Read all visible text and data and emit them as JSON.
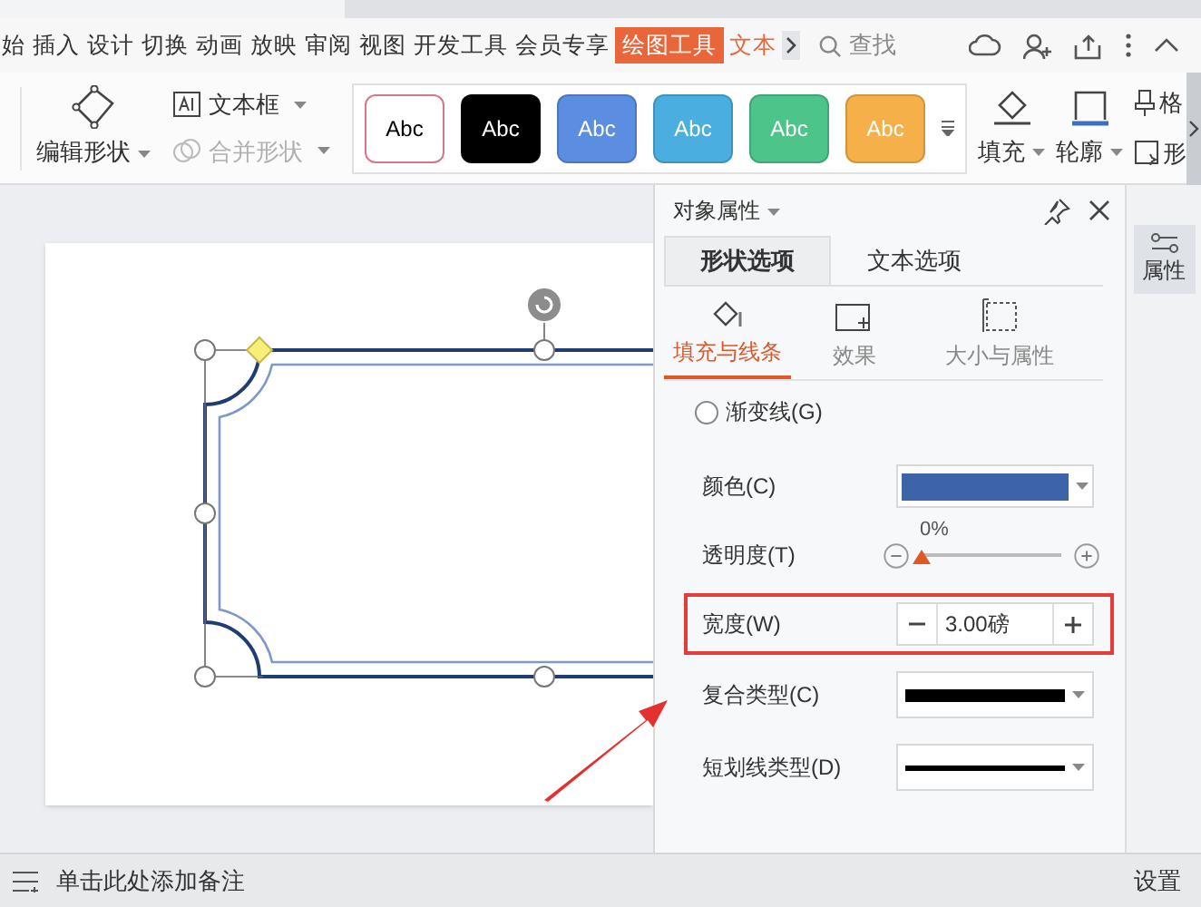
{
  "menu_tabs": [
    {
      "label": "始",
      "selected": false
    },
    {
      "label": "插入",
      "selected": false
    },
    {
      "label": "设计",
      "selected": false
    },
    {
      "label": "切换",
      "selected": false
    },
    {
      "label": "动画",
      "selected": false
    },
    {
      "label": "放映",
      "selected": false
    },
    {
      "label": "审阅",
      "selected": false
    },
    {
      "label": "视图",
      "selected": false
    },
    {
      "label": "开发工具",
      "selected": false
    },
    {
      "label": "会员专享",
      "selected": false
    },
    {
      "label": "绘图工具",
      "selected": true
    },
    {
      "label": "文本",
      "selected": false
    }
  ],
  "search": {
    "placeholder": "查找"
  },
  "ribbon": {
    "edit_shape": "编辑形状",
    "text_box": "文本框",
    "merge_shape": {
      "label": "合并形状",
      "disabled": true
    },
    "styles": [
      {
        "label": "Abc",
        "color": "#ffffff"
      },
      {
        "label": "Abc",
        "color": "#000000"
      },
      {
        "label": "Abc",
        "color": "#5b8ee0"
      },
      {
        "label": "Abc",
        "color": "#4aaee0"
      },
      {
        "label": "Abc",
        "color": "#4dc48a"
      },
      {
        "label": "Abc",
        "color": "#f6b04a"
      }
    ],
    "fill": "填充",
    "outline": "轮廓",
    "format_cut": "格",
    "shape_cut": "形"
  },
  "panel": {
    "title": "对象属性",
    "tabs": [
      {
        "label": "形状选项",
        "selected": true
      },
      {
        "label": "文本选项",
        "selected": false
      }
    ],
    "subtabs": [
      {
        "label": "填充与线条",
        "selected": true
      },
      {
        "label": "效果",
        "selected": false
      },
      {
        "label": "大小与属性",
        "selected": false
      }
    ],
    "gradient_line": {
      "label": "渐变线(G)",
      "selected": false
    },
    "color": {
      "label": "颜色(C)",
      "color": "#3d64a8"
    },
    "transparency": {
      "label": "透明度(T)",
      "reading": "0%",
      "level": 0
    },
    "width": {
      "label": "宽度(W)",
      "value": "3.00磅",
      "highlighted": true
    },
    "compound_type": {
      "label": "复合类型(C)"
    },
    "dash_type": {
      "label": "短划线类型(D)"
    }
  },
  "side_bar": {
    "label": "属性",
    "selected": true
  },
  "status_bar": {
    "notes": "单击此处添加备注",
    "settings": "设置"
  }
}
